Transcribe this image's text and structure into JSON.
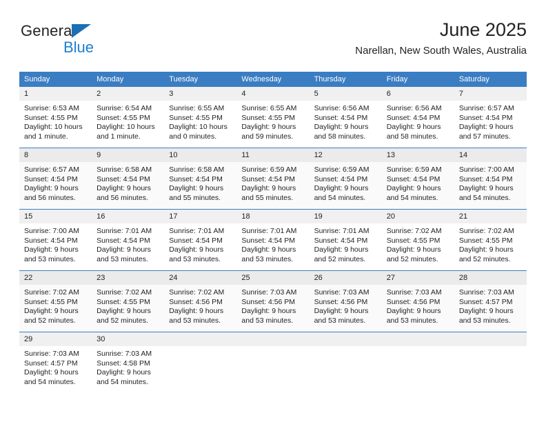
{
  "logo": {
    "word_one": "General",
    "word_two": "Blue",
    "triangle_icon": "triangle-icon",
    "brand_blue": "#1b7fd1",
    "brand_dark_blue": "#1b6fb5"
  },
  "header": {
    "title": "June 2025",
    "subtitle": "Narellan, New South Wales, Australia"
  },
  "calendar": {
    "header_color": "#3b7dc2",
    "weekday_headers": [
      "Sunday",
      "Monday",
      "Tuesday",
      "Wednesday",
      "Thursday",
      "Friday",
      "Saturday"
    ],
    "weeks": [
      {
        "shaded": false,
        "days": [
          {
            "day": "1",
            "sunrise": "Sunrise: 6:53 AM",
            "sunset": "Sunset: 4:55 PM",
            "daylight_line1": "Daylight: 10 hours",
            "daylight_line2": "and 1 minute."
          },
          {
            "day": "2",
            "sunrise": "Sunrise: 6:54 AM",
            "sunset": "Sunset: 4:55 PM",
            "daylight_line1": "Daylight: 10 hours",
            "daylight_line2": "and 1 minute."
          },
          {
            "day": "3",
            "sunrise": "Sunrise: 6:55 AM",
            "sunset": "Sunset: 4:55 PM",
            "daylight_line1": "Daylight: 10 hours",
            "daylight_line2": "and 0 minutes."
          },
          {
            "day": "4",
            "sunrise": "Sunrise: 6:55 AM",
            "sunset": "Sunset: 4:55 PM",
            "daylight_line1": "Daylight: 9 hours",
            "daylight_line2": "and 59 minutes."
          },
          {
            "day": "5",
            "sunrise": "Sunrise: 6:56 AM",
            "sunset": "Sunset: 4:54 PM",
            "daylight_line1": "Daylight: 9 hours",
            "daylight_line2": "and 58 minutes."
          },
          {
            "day": "6",
            "sunrise": "Sunrise: 6:56 AM",
            "sunset": "Sunset: 4:54 PM",
            "daylight_line1": "Daylight: 9 hours",
            "daylight_line2": "and 58 minutes."
          },
          {
            "day": "7",
            "sunrise": "Sunrise: 6:57 AM",
            "sunset": "Sunset: 4:54 PM",
            "daylight_line1": "Daylight: 9 hours",
            "daylight_line2": "and 57 minutes."
          }
        ]
      },
      {
        "shaded": true,
        "days": [
          {
            "day": "8",
            "sunrise": "Sunrise: 6:57 AM",
            "sunset": "Sunset: 4:54 PM",
            "daylight_line1": "Daylight: 9 hours",
            "daylight_line2": "and 56 minutes."
          },
          {
            "day": "9",
            "sunrise": "Sunrise: 6:58 AM",
            "sunset": "Sunset: 4:54 PM",
            "daylight_line1": "Daylight: 9 hours",
            "daylight_line2": "and 56 minutes."
          },
          {
            "day": "10",
            "sunrise": "Sunrise: 6:58 AM",
            "sunset": "Sunset: 4:54 PM",
            "daylight_line1": "Daylight: 9 hours",
            "daylight_line2": "and 55 minutes."
          },
          {
            "day": "11",
            "sunrise": "Sunrise: 6:59 AM",
            "sunset": "Sunset: 4:54 PM",
            "daylight_line1": "Daylight: 9 hours",
            "daylight_line2": "and 55 minutes."
          },
          {
            "day": "12",
            "sunrise": "Sunrise: 6:59 AM",
            "sunset": "Sunset: 4:54 PM",
            "daylight_line1": "Daylight: 9 hours",
            "daylight_line2": "and 54 minutes."
          },
          {
            "day": "13",
            "sunrise": "Sunrise: 6:59 AM",
            "sunset": "Sunset: 4:54 PM",
            "daylight_line1": "Daylight: 9 hours",
            "daylight_line2": "and 54 minutes."
          },
          {
            "day": "14",
            "sunrise": "Sunrise: 7:00 AM",
            "sunset": "Sunset: 4:54 PM",
            "daylight_line1": "Daylight: 9 hours",
            "daylight_line2": "and 54 minutes."
          }
        ]
      },
      {
        "shaded": false,
        "days": [
          {
            "day": "15",
            "sunrise": "Sunrise: 7:00 AM",
            "sunset": "Sunset: 4:54 PM",
            "daylight_line1": "Daylight: 9 hours",
            "daylight_line2": "and 53 minutes."
          },
          {
            "day": "16",
            "sunrise": "Sunrise: 7:01 AM",
            "sunset": "Sunset: 4:54 PM",
            "daylight_line1": "Daylight: 9 hours",
            "daylight_line2": "and 53 minutes."
          },
          {
            "day": "17",
            "sunrise": "Sunrise: 7:01 AM",
            "sunset": "Sunset: 4:54 PM",
            "daylight_line1": "Daylight: 9 hours",
            "daylight_line2": "and 53 minutes."
          },
          {
            "day": "18",
            "sunrise": "Sunrise: 7:01 AM",
            "sunset": "Sunset: 4:54 PM",
            "daylight_line1": "Daylight: 9 hours",
            "daylight_line2": "and 53 minutes."
          },
          {
            "day": "19",
            "sunrise": "Sunrise: 7:01 AM",
            "sunset": "Sunset: 4:54 PM",
            "daylight_line1": "Daylight: 9 hours",
            "daylight_line2": "and 52 minutes."
          },
          {
            "day": "20",
            "sunrise": "Sunrise: 7:02 AM",
            "sunset": "Sunset: 4:55 PM",
            "daylight_line1": "Daylight: 9 hours",
            "daylight_line2": "and 52 minutes."
          },
          {
            "day": "21",
            "sunrise": "Sunrise: 7:02 AM",
            "sunset": "Sunset: 4:55 PM",
            "daylight_line1": "Daylight: 9 hours",
            "daylight_line2": "and 52 minutes."
          }
        ]
      },
      {
        "shaded": true,
        "days": [
          {
            "day": "22",
            "sunrise": "Sunrise: 7:02 AM",
            "sunset": "Sunset: 4:55 PM",
            "daylight_line1": "Daylight: 9 hours",
            "daylight_line2": "and 52 minutes."
          },
          {
            "day": "23",
            "sunrise": "Sunrise: 7:02 AM",
            "sunset": "Sunset: 4:55 PM",
            "daylight_line1": "Daylight: 9 hours",
            "daylight_line2": "and 52 minutes."
          },
          {
            "day": "24",
            "sunrise": "Sunrise: 7:02 AM",
            "sunset": "Sunset: 4:56 PM",
            "daylight_line1": "Daylight: 9 hours",
            "daylight_line2": "and 53 minutes."
          },
          {
            "day": "25",
            "sunrise": "Sunrise: 7:03 AM",
            "sunset": "Sunset: 4:56 PM",
            "daylight_line1": "Daylight: 9 hours",
            "daylight_line2": "and 53 minutes."
          },
          {
            "day": "26",
            "sunrise": "Sunrise: 7:03 AM",
            "sunset": "Sunset: 4:56 PM",
            "daylight_line1": "Daylight: 9 hours",
            "daylight_line2": "and 53 minutes."
          },
          {
            "day": "27",
            "sunrise": "Sunrise: 7:03 AM",
            "sunset": "Sunset: 4:56 PM",
            "daylight_line1": "Daylight: 9 hours",
            "daylight_line2": "and 53 minutes."
          },
          {
            "day": "28",
            "sunrise": "Sunrise: 7:03 AM",
            "sunset": "Sunset: 4:57 PM",
            "daylight_line1": "Daylight: 9 hours",
            "daylight_line2": "and 53 minutes."
          }
        ]
      },
      {
        "shaded": false,
        "days": [
          {
            "day": "29",
            "sunrise": "Sunrise: 7:03 AM",
            "sunset": "Sunset: 4:57 PM",
            "daylight_line1": "Daylight: 9 hours",
            "daylight_line2": "and 54 minutes."
          },
          {
            "day": "30",
            "sunrise": "Sunrise: 7:03 AM",
            "sunset": "Sunset: 4:58 PM",
            "daylight_line1": "Daylight: 9 hours",
            "daylight_line2": "and 54 minutes."
          },
          {
            "day": "",
            "sunrise": "",
            "sunset": "",
            "daylight_line1": "",
            "daylight_line2": ""
          },
          {
            "day": "",
            "sunrise": "",
            "sunset": "",
            "daylight_line1": "",
            "daylight_line2": ""
          },
          {
            "day": "",
            "sunrise": "",
            "sunset": "",
            "daylight_line1": "",
            "daylight_line2": ""
          },
          {
            "day": "",
            "sunrise": "",
            "sunset": "",
            "daylight_line1": "",
            "daylight_line2": ""
          },
          {
            "day": "",
            "sunrise": "",
            "sunset": "",
            "daylight_line1": "",
            "daylight_line2": ""
          }
        ]
      }
    ]
  }
}
